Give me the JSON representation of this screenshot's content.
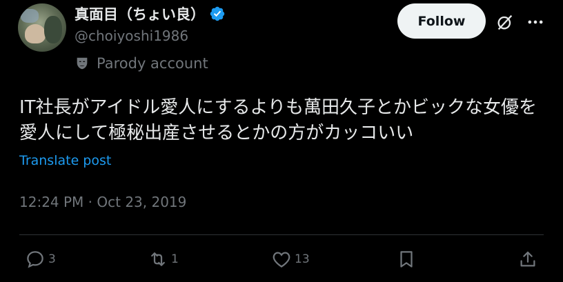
{
  "author": {
    "display_name": "真面目（ちょい良）",
    "handle": "@choiyoshi1986",
    "verified": true,
    "account_label": "Parody account"
  },
  "header": {
    "follow_label": "Follow"
  },
  "tweet": {
    "text": "IT社長がアイドル愛人にするよりも萬田久子とかビックな女優を愛人にして極秘出産させるとかの方がカッコいい",
    "translate_label": "Translate post",
    "timestamp": "12:24 PM · Oct 23, 2019"
  },
  "actions": {
    "replies": "3",
    "reposts": "1",
    "likes": "13"
  },
  "icons": [
    "verified-icon",
    "mask-icon",
    "grok-icon",
    "more-icon",
    "reply-icon",
    "retweet-icon",
    "heart-icon",
    "bookmark-icon",
    "share-icon"
  ],
  "colors": {
    "background": "#000000",
    "text": "#e7e9ea",
    "muted": "#71767b",
    "link": "#1d9bf0",
    "verified": "#1d9bf0",
    "follow_bg": "#eff3f4"
  }
}
